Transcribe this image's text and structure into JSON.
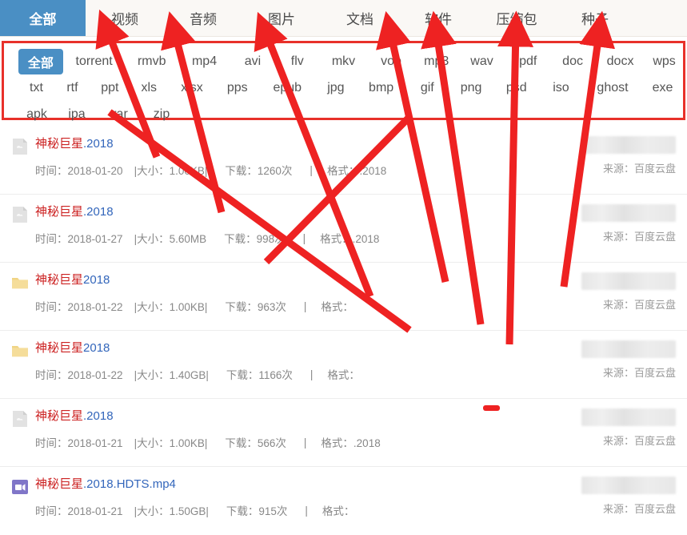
{
  "tabs": [
    {
      "label": "全部",
      "selected": true
    },
    {
      "label": "视频",
      "selected": false
    },
    {
      "label": "音频",
      "selected": false
    },
    {
      "label": "图片",
      "selected": false
    },
    {
      "label": "文档",
      "selected": false
    },
    {
      "label": "软件",
      "selected": false
    },
    {
      "label": "压缩包",
      "selected": false
    },
    {
      "label": "种子",
      "selected": false
    }
  ],
  "filter_panel": {
    "border_color": "#e8312a",
    "selected_color": "#4a8fc4",
    "rows": [
      [
        {
          "label": "全部",
          "selected": true
        },
        {
          "label": "torrent",
          "selected": false
        },
        {
          "label": "rmvb",
          "selected": false
        },
        {
          "label": "mp4",
          "selected": false
        },
        {
          "label": "avi",
          "selected": false
        },
        {
          "label": "flv",
          "selected": false
        },
        {
          "label": "mkv",
          "selected": false
        },
        {
          "label": "vob",
          "selected": false
        },
        {
          "label": "mp3",
          "selected": false
        },
        {
          "label": "wav",
          "selected": false
        },
        {
          "label": "pdf",
          "selected": false
        },
        {
          "label": "doc",
          "selected": false
        },
        {
          "label": "docx",
          "selected": false
        },
        {
          "label": "wps",
          "selected": false
        }
      ],
      [
        {
          "label": "txt",
          "selected": false
        },
        {
          "label": "rtf",
          "selected": false
        },
        {
          "label": "ppt",
          "selected": false
        },
        {
          "label": "xls",
          "selected": false
        },
        {
          "label": "xlsx",
          "selected": false
        },
        {
          "label": "pps",
          "selected": false
        },
        {
          "label": "epub",
          "selected": false
        },
        {
          "label": "jpg",
          "selected": false
        },
        {
          "label": "bmp",
          "selected": false
        },
        {
          "label": "gif",
          "selected": false
        },
        {
          "label": "png",
          "selected": false
        },
        {
          "label": "psd",
          "selected": false
        },
        {
          "label": "iso",
          "selected": false
        },
        {
          "label": "ghost",
          "selected": false
        },
        {
          "label": "exe",
          "selected": false
        }
      ],
      [
        {
          "label": "apk",
          "selected": false
        },
        {
          "label": "ipa",
          "selected": false
        },
        {
          "label": "rar",
          "selected": false
        },
        {
          "label": "zip",
          "selected": false
        }
      ]
    ]
  },
  "meta_labels": {
    "time_prefix": "时间：",
    "size_prefix": "|大小：",
    "download_prefix": "下载：",
    "download_suffix": "次",
    "separator": "|",
    "format_prefix": "格式：",
    "source_prefix": "来源：",
    "source_value": "百度云盘"
  },
  "results": [
    {
      "icon": "cloud-file-icon",
      "title_highlight": "神秘巨星",
      "title_rest": ".2018",
      "time": "2018-01-20",
      "size": "1.00KB|",
      "downloads": "1260",
      "format": ".2018",
      "source": "来源：百度云盘"
    },
    {
      "icon": "cloud-file-icon",
      "title_highlight": "神秘巨星",
      "title_rest": ".2018",
      "time": "2018-01-27",
      "size": "5.60MB",
      "downloads": "998",
      "format": ".2018",
      "source": "来源：百度云盘"
    },
    {
      "icon": "folder-icon",
      "title_highlight": "神秘巨星",
      "title_rest": "2018",
      "time": "2018-01-22",
      "size": "1.00KB|",
      "downloads": "963",
      "format": "",
      "source": "来源：百度云盘"
    },
    {
      "icon": "folder-icon",
      "title_highlight": "神秘巨星",
      "title_rest": "2018",
      "time": "2018-01-22",
      "size": "1.40GB|",
      "downloads": "1166",
      "format": "",
      "source": "来源：百度云盘"
    },
    {
      "icon": "cloud-file-icon",
      "title_highlight": "神秘巨星",
      "title_rest": ".2018",
      "time": "2018-01-21",
      "size": "1.00KB|",
      "downloads": "566",
      "format": ".2018",
      "source": "来源：百度云盘"
    },
    {
      "icon": "video-icon",
      "title_highlight": "神秘巨星",
      "title_rest": ".2018.HDTS.mp4",
      "time": "2018-01-21",
      "size": "1.50GB|",
      "downloads": "915",
      "format": "",
      "source": "来源：百度云盘"
    }
  ],
  "annotation": {
    "color": "#ee2222",
    "description": "red-arrows-and-crosses-overlay"
  }
}
